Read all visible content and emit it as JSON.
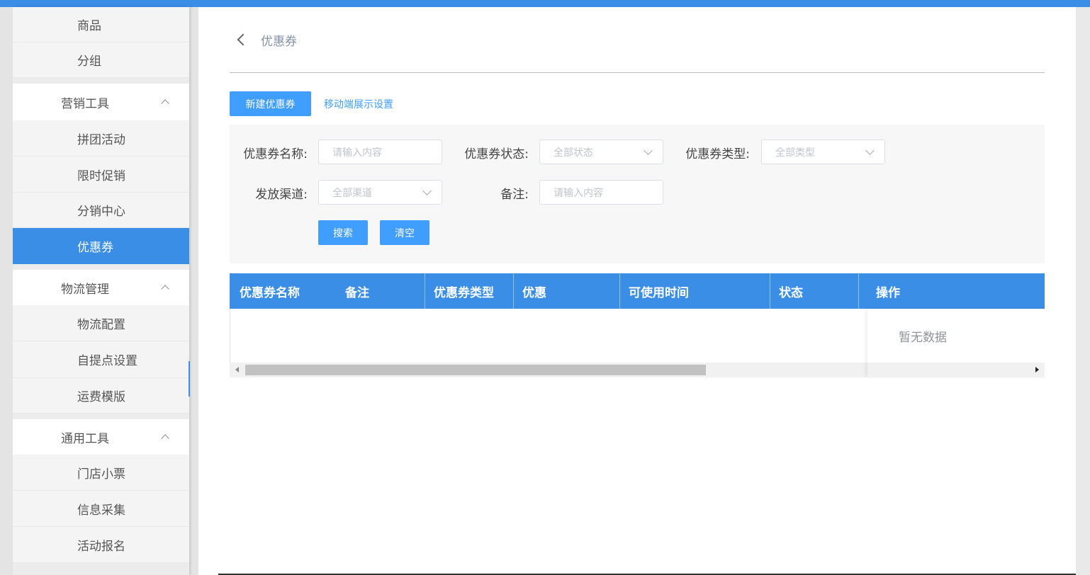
{
  "sidebar": {
    "items": [
      {
        "label": "商品",
        "type": "sub"
      },
      {
        "label": "分组",
        "type": "sub"
      },
      {
        "label": "营销工具",
        "type": "group"
      },
      {
        "label": "拼团活动",
        "type": "sub"
      },
      {
        "label": "限时促销",
        "type": "sub"
      },
      {
        "label": "分销中心",
        "type": "sub"
      },
      {
        "label": "优惠券",
        "type": "sub",
        "active": true
      },
      {
        "label": "物流管理",
        "type": "group"
      },
      {
        "label": "物流配置",
        "type": "sub"
      },
      {
        "label": "自提点设置",
        "type": "sub"
      },
      {
        "label": "运费模版",
        "type": "sub"
      },
      {
        "label": "通用工具",
        "type": "group"
      },
      {
        "label": "门店小票",
        "type": "sub"
      },
      {
        "label": "信息采集",
        "type": "sub"
      },
      {
        "label": "活动报名",
        "type": "sub"
      }
    ]
  },
  "header": {
    "title": "优惠券"
  },
  "toolbar": {
    "new_label": "新建优惠券",
    "mobile_settings_label": "移动端展示设置"
  },
  "filter": {
    "name_label": "优惠券名称:",
    "name_placeholder": "请输入内容",
    "status_label": "优惠券状态:",
    "status_value": "全部状态",
    "type_label": "优惠券类型:",
    "type_value": "全部类型",
    "channel_label": "发放渠道:",
    "channel_value": "全部渠道",
    "remark_label": "备注:",
    "remark_placeholder": "请输入内容",
    "search_label": "搜索",
    "clear_label": "清空"
  },
  "table": {
    "columns": [
      "优惠券名称",
      "备注",
      "优惠券类型",
      "优惠",
      "可使用时间",
      "状态",
      "操作"
    ],
    "empty_text": "暂无数据"
  },
  "colors": {
    "primary": "#409eff",
    "header_blue": "#3a8ee6"
  }
}
